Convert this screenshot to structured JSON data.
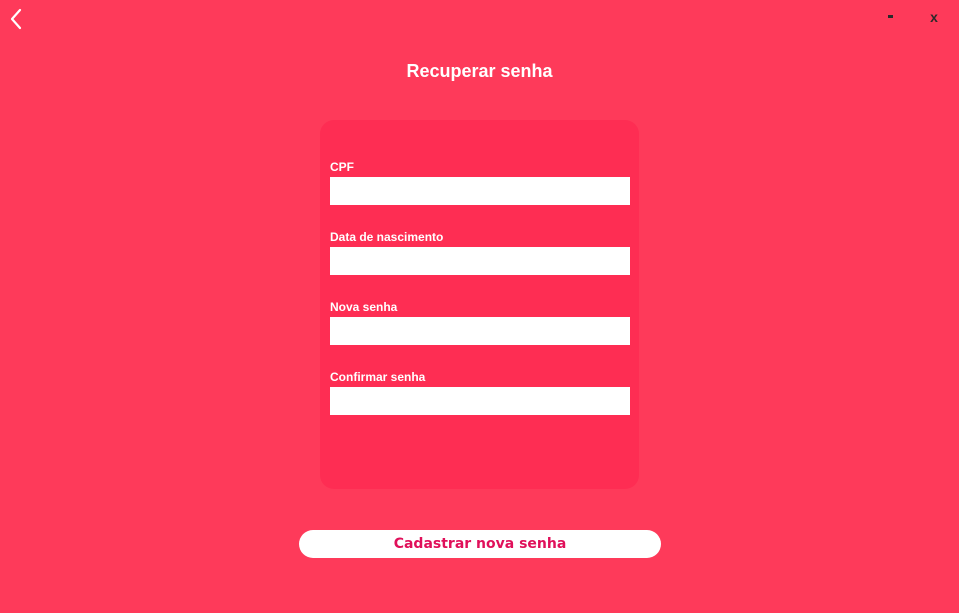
{
  "window": {
    "minimize_label": "-",
    "close_label": "x",
    "back_icon": "chevron-left-icon"
  },
  "page": {
    "title": "Recuperar senha"
  },
  "form": {
    "fields": [
      {
        "label": "CPF",
        "value": ""
      },
      {
        "label": "Data de nascimento",
        "value": ""
      },
      {
        "label": "Nova senha",
        "value": ""
      },
      {
        "label": "Confirmar senha",
        "value": ""
      }
    ],
    "submit_label": "Cadastrar nova senha"
  },
  "colors": {
    "background": "#fe3a5a",
    "card": "#fe2d53",
    "input": "#ffffff",
    "button_text": "#e0105a"
  }
}
